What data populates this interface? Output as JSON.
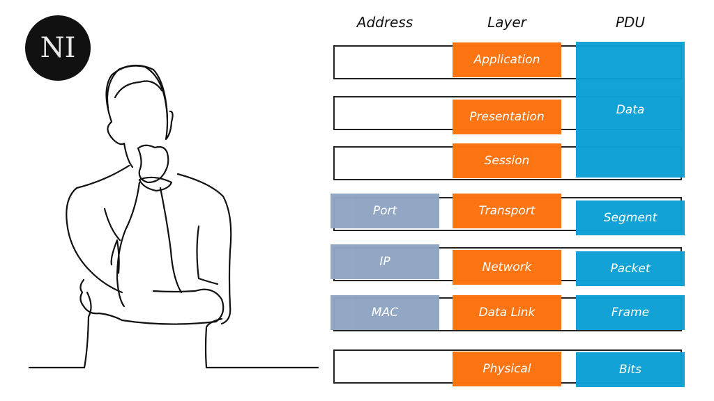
{
  "logo": {
    "text": "NI"
  },
  "headers": {
    "address": "Address",
    "layer": "Layer",
    "pdu": "PDU"
  },
  "colors": {
    "layer": "#fd730f",
    "pdu": "#0ca0d4",
    "address": "#8fa5c3"
  },
  "layers": [
    {
      "name": "Application",
      "address": null,
      "pdu": "Data"
    },
    {
      "name": "Presentation",
      "address": null,
      "pdu": "Data"
    },
    {
      "name": "Session",
      "address": null,
      "pdu": "Data"
    },
    {
      "name": "Transport",
      "address": "Port",
      "pdu": "Segment"
    },
    {
      "name": "Network",
      "address": "IP",
      "pdu": "Packet"
    },
    {
      "name": "Data Link",
      "address": "MAC",
      "pdu": "Frame"
    },
    {
      "name": "Physical",
      "address": null,
      "pdu": "Bits"
    }
  ],
  "data_pdu_label": "Data"
}
